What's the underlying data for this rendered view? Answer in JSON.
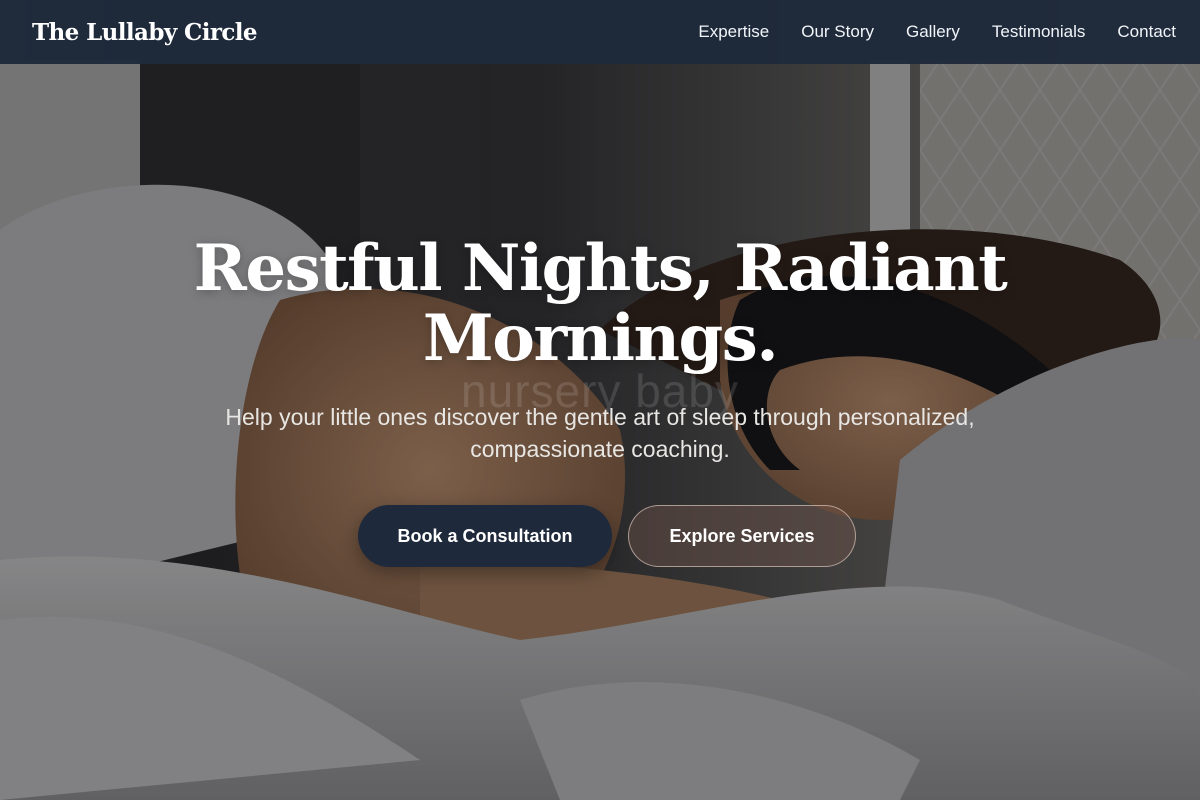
{
  "brand": {
    "name": "The Lullaby Circle"
  },
  "nav": {
    "items": [
      {
        "label": "Expertise"
      },
      {
        "label": "Our Story"
      },
      {
        "label": "Gallery"
      },
      {
        "label": "Testimonials"
      },
      {
        "label": "Contact"
      }
    ]
  },
  "hero": {
    "title_line1": "Restful Nights, Radiant",
    "title_line2": "Mornings.",
    "ghost_text": "nursery baby",
    "subtitle_line1": "Help your little ones discover the gentle art of sleep through personalized,",
    "subtitle_line2": "compassionate coaching.",
    "primary_button": "Book a Consultation",
    "secondary_button": "Explore Services"
  },
  "colors": {
    "navbar_bg": "#1e293b",
    "primary_button_bg": "#1e293b",
    "text_light": "#ffffff"
  }
}
